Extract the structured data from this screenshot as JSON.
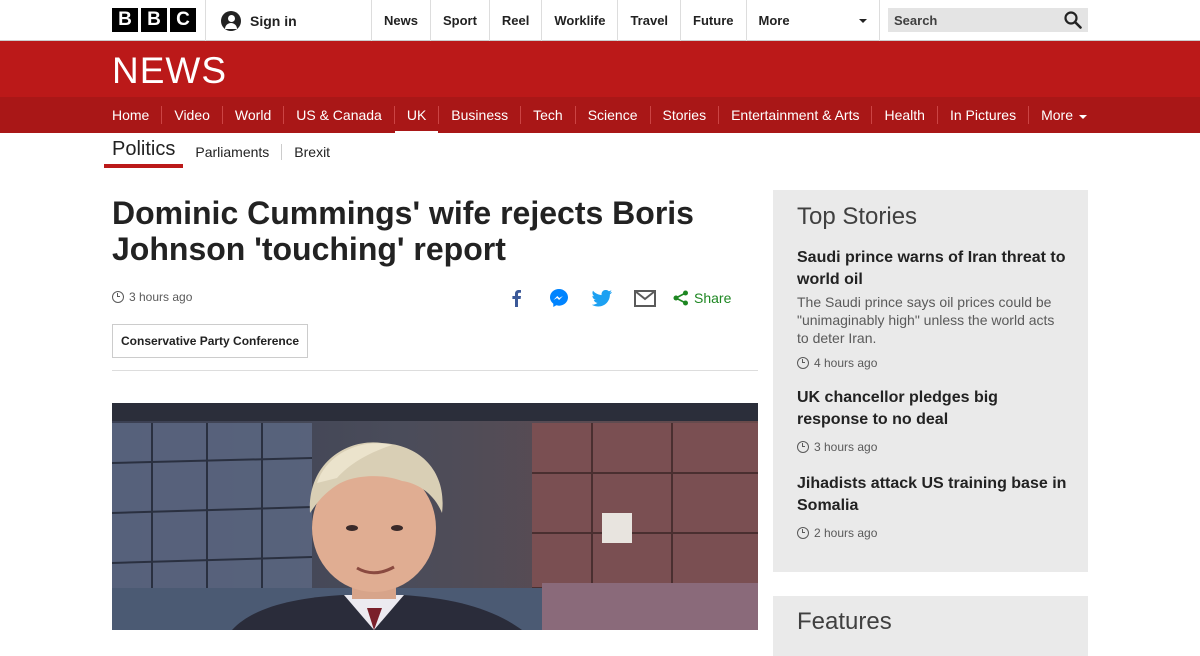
{
  "brand": {
    "letters": [
      "B",
      "B",
      "C"
    ],
    "news_logo": "NEWS",
    "red": "#bb1919"
  },
  "account": {
    "signin_label": "Sign in",
    "icon": "user-icon"
  },
  "top_nav": {
    "items": [
      "News",
      "Sport",
      "Reel",
      "Worklife",
      "Travel",
      "Future"
    ],
    "more_label": "More"
  },
  "search": {
    "placeholder": "Search",
    "icon": "search-icon"
  },
  "section_nav": {
    "items": [
      "Home",
      "Video",
      "World",
      "US & Canada",
      "UK",
      "Business",
      "Tech",
      "Science",
      "Stories",
      "Entertainment & Arts",
      "Health",
      "In Pictures"
    ],
    "active": "UK",
    "more_label": "More"
  },
  "sub_nav": {
    "title": "Politics",
    "items": [
      "Parliaments",
      "Brexit"
    ]
  },
  "article": {
    "headline": "Dominic Cummings' wife rejects Boris Johnson 'touching' report",
    "timestamp": "3 hours ago",
    "share_label": "Share",
    "share_icons": [
      "facebook-icon",
      "messenger-icon",
      "twitter-icon",
      "email-icon"
    ],
    "tag": "Conservative Party Conference"
  },
  "top_stories": {
    "title": "Top Stories",
    "stories": [
      {
        "headline": "Saudi prince warns of Iran threat to world oil",
        "summary": "The Saudi prince says oil prices could be \"unimaginably high\" unless the world acts to deter Iran.",
        "time": "4 hours ago"
      },
      {
        "headline": "UK chancellor pledges big response to no deal",
        "summary": "",
        "time": "3 hours ago"
      },
      {
        "headline": "Jihadists attack US training base in Somalia",
        "summary": "",
        "time": "2 hours ago"
      }
    ]
  },
  "features": {
    "title": "Features"
  }
}
